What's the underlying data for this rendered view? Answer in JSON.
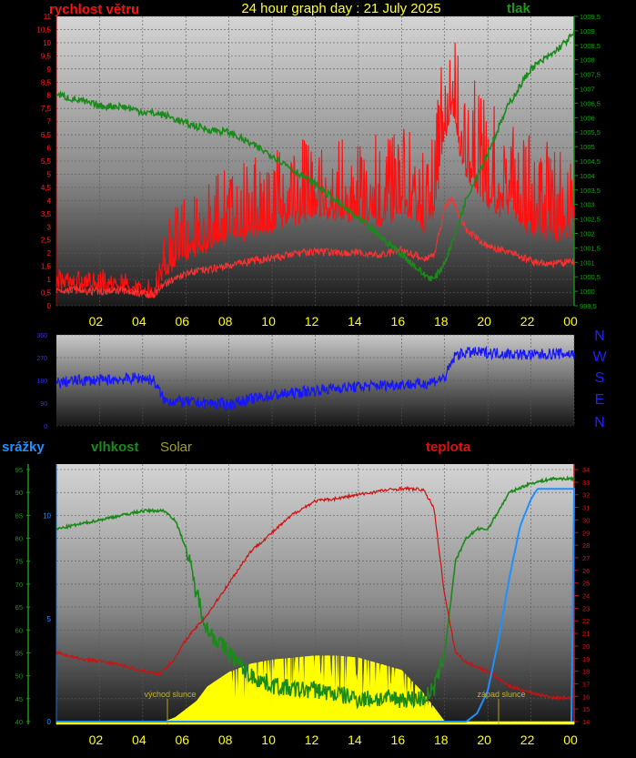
{
  "header": {
    "title": "24 hour graph day : 21 July 2025",
    "left_label": "rychlost větru",
    "right_label": "tlak"
  },
  "compass": [
    "N",
    "W",
    "S",
    "E",
    "N"
  ],
  "lower_labels": {
    "rain": "srážky",
    "humidity": "vlhkost",
    "solar": "Solar",
    "temperature": "teplota",
    "sunrise": "východ slunce",
    "sunset": "západ slunce"
  },
  "colors": {
    "wind": "#ff1010",
    "pressure": "#1a8a1a",
    "direction": "#1515ff",
    "temperature": "#d01010",
    "humidity": "#1a8a1a",
    "solar": "#ffff00",
    "rain": "#1e90ff",
    "title": "#ffff33",
    "tick_text": "#ffff00"
  },
  "chart_data": [
    {
      "type": "line",
      "name": "wind-and-pressure",
      "x_ticks": [
        "02",
        "04",
        "06",
        "08",
        "10",
        "12",
        "14",
        "16",
        "18",
        "20",
        "22",
        "00"
      ],
      "x_range_hours": [
        0,
        24
      ],
      "y_left_ticks": [
        "0",
        "0,5",
        "1",
        "1,5",
        "2",
        "2,5",
        "3",
        "3,5",
        "4",
        "4,5",
        "5",
        "5,5",
        "6",
        "6,5",
        "7",
        "7,5",
        "8",
        "8,5",
        "9",
        "9,5",
        "10",
        "10,5",
        "11"
      ],
      "y_left_range": [
        0,
        11
      ],
      "y_right_ticks": [
        "999,5",
        "1000",
        "1000,5",
        "1001",
        "1001,5",
        "1002",
        "1002,5",
        "1003",
        "1003,5",
        "1004",
        "1004,5",
        "1005",
        "1005,5",
        "1006",
        "1006,5",
        "1007",
        "1007,5",
        "1008",
        "1008,5",
        "1009",
        "1009,5"
      ],
      "y_right_range": [
        999.5,
        1009.5
      ],
      "series": [
        {
          "name": "rychlost větru",
          "axis": "left",
          "x": [
            0,
            1,
            2,
            3,
            4,
            4.5,
            5,
            6,
            7,
            8,
            9,
            10,
            11,
            12,
            13,
            14,
            15,
            16,
            17,
            17.5,
            18,
            18.3,
            19,
            20,
            21,
            22,
            23,
            24
          ],
          "y": [
            0.8,
            0.8,
            0.7,
            0.8,
            0.6,
            0.5,
            1.2,
            2.0,
            2.2,
            2.5,
            2.8,
            3.0,
            3.3,
            3.5,
            3.4,
            3.4,
            3.2,
            3.6,
            3.0,
            3.2,
            6.5,
            7.2,
            5.0,
            3.8,
            3.5,
            2.8,
            2.6,
            2.8
          ],
          "peak": [
            1.5,
            1.5,
            1.5,
            1.5,
            1.2,
            1.0,
            3.5,
            4.5,
            5.0,
            5.5,
            6.0,
            6.0,
            6.3,
            6.5,
            6.5,
            6.5,
            6.8,
            7.0,
            6.5,
            7.0,
            11.2,
            10.5,
            9.5,
            8.0,
            7.5,
            6.5,
            6.5,
            6.5
          ]
        },
        {
          "name": "tlak",
          "axis": "right",
          "x": [
            0,
            1,
            2,
            3,
            4,
            5,
            6,
            7,
            8,
            9,
            10,
            11,
            12,
            13,
            14,
            15,
            16,
            17,
            17.5,
            18,
            18.5,
            19,
            20,
            21,
            22,
            23,
            24
          ],
          "y": [
            1006.8,
            1006.6,
            1006.4,
            1006.4,
            1006.2,
            1006.1,
            1005.8,
            1005.6,
            1005.5,
            1005.1,
            1004.7,
            1004.2,
            1003.7,
            1003.1,
            1002.5,
            1001.9,
            1001.3,
            1000.6,
            1000.4,
            1001.0,
            1002.0,
            1003.2,
            1004.8,
            1006.5,
            1007.7,
            1008.2,
            1008.9
          ]
        }
      ]
    },
    {
      "type": "line",
      "name": "wind-direction",
      "y_ticks": [
        "0",
        "90",
        "180",
        "270",
        "360"
      ],
      "y_range": [
        0,
        360
      ],
      "series": [
        {
          "name": "direction",
          "x": [
            0,
            1,
            2,
            3,
            4,
            4.5,
            5,
            6,
            7,
            8,
            9,
            10,
            11,
            12,
            13,
            14,
            15,
            16,
            17,
            18,
            18.5,
            19,
            20,
            21,
            22,
            23,
            24
          ],
          "y": [
            170,
            180,
            180,
            185,
            190,
            180,
            100,
            95,
            90,
            85,
            105,
            120,
            130,
            140,
            150,
            155,
            160,
            165,
            165,
            190,
            280,
            290,
            290,
            285,
            280,
            285,
            285
          ]
        }
      ]
    },
    {
      "type": "line",
      "name": "rain-humidity-solar-temperature",
      "y_left_ticks": [
        "0",
        "5",
        "10"
      ],
      "y_left_range": [
        0,
        12.5
      ],
      "y_hum_ticks": [
        "40",
        "45",
        "50",
        "55",
        "60",
        "65",
        "70",
        "75",
        "80",
        "85",
        "90",
        "95"
      ],
      "y_hum_range": [
        40,
        95
      ],
      "y_right_ticks": [
        "14",
        "15",
        "16",
        "17",
        "18",
        "19",
        "20",
        "21",
        "22",
        "23",
        "24",
        "25",
        "26",
        "27",
        "28",
        "29",
        "30",
        "31",
        "32",
        "33",
        "34"
      ],
      "y_right_range": [
        14,
        34
      ],
      "series": [
        {
          "name": "teplota",
          "axis": "right",
          "x": [
            0,
            1,
            2,
            3,
            4,
            4.8,
            5.5,
            6,
            7,
            8,
            9,
            10,
            11,
            12,
            13,
            14,
            15,
            16,
            17,
            17.5,
            18,
            18.5,
            19,
            20,
            21,
            22,
            23,
            24
          ],
          "y": [
            19.5,
            19.0,
            18.8,
            18.5,
            18.0,
            17.8,
            19.0,
            20.5,
            22.5,
            25.0,
            27.5,
            29.0,
            30.5,
            31.5,
            31.7,
            32.0,
            32.3,
            32.5,
            32.4,
            31.0,
            24.0,
            19.5,
            18.7,
            18.0,
            16.8,
            16.3,
            15.9,
            15.9
          ]
        },
        {
          "name": "vlhkost",
          "axis": "humidity",
          "x": [
            0,
            1,
            2,
            3,
            4,
            5,
            5.5,
            6,
            6.5,
            7,
            8,
            9,
            10,
            11,
            12,
            13,
            14,
            15,
            16,
            17,
            17.5,
            18,
            18.5,
            19,
            19.5,
            20,
            21,
            22,
            23,
            24
          ],
          "y": [
            82,
            83,
            84,
            85,
            86,
            86,
            84,
            78,
            68,
            60,
            55,
            50,
            48,
            47,
            47,
            46,
            45,
            45,
            45,
            45,
            47,
            55,
            75,
            80,
            82,
            82,
            90,
            92,
            93,
            93
          ]
        },
        {
          "name": "Solar",
          "axis": "left",
          "x": [
            0,
            5,
            5.5,
            6,
            6.5,
            7,
            8,
            9,
            10,
            11,
            12,
            13,
            14,
            15,
            16,
            17,
            17.5,
            18,
            24
          ],
          "y": [
            0,
            0,
            0.2,
            0.6,
            1.0,
            1.7,
            2.4,
            2.8,
            3.0,
            3.1,
            3.2,
            3.2,
            3.1,
            2.8,
            2.5,
            1.4,
            0.7,
            0,
            0
          ]
        },
        {
          "name": "srážky",
          "axis": "left",
          "x": [
            0,
            19,
            19.5,
            20,
            20.5,
            21,
            21.5,
            22,
            22.3,
            23,
            24
          ],
          "y": [
            0,
            0,
            0.4,
            1.5,
            4.0,
            7.0,
            9.5,
            10.8,
            11.3,
            11.3,
            11.3
          ]
        }
      ]
    }
  ]
}
